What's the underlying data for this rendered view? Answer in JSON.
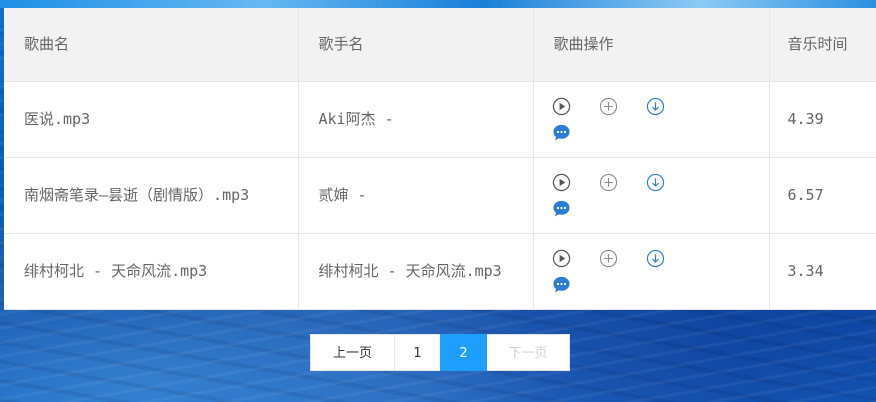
{
  "table": {
    "headers": {
      "song": "歌曲名",
      "artist": "歌手名",
      "ops": "歌曲操作",
      "time": "音乐时间"
    },
    "rows": [
      {
        "song": "医说.mp3",
        "artist": "Aki阿杰 -",
        "time": "4.39"
      },
      {
        "song": "南烟斋笔录—昙逝（剧情版）.mp3",
        "artist": "贰婶 -",
        "time": "6.57"
      },
      {
        "song": "绯村柯北 - 天命风流.mp3",
        "artist": "绯村柯北 - 天命风流.mp3",
        "time": "3.34"
      }
    ],
    "row_icons": [
      "play-icon",
      "add-icon",
      "download-icon",
      "comment-icon"
    ]
  },
  "pagination": {
    "prev": "上一页",
    "pages": [
      "1",
      "2"
    ],
    "current": "2",
    "next": "下一页"
  },
  "colors": {
    "accent": "#1e9fff",
    "header_bg": "#f2f2f2",
    "text": "#666666",
    "icon_blue": "#2b7cd3"
  }
}
